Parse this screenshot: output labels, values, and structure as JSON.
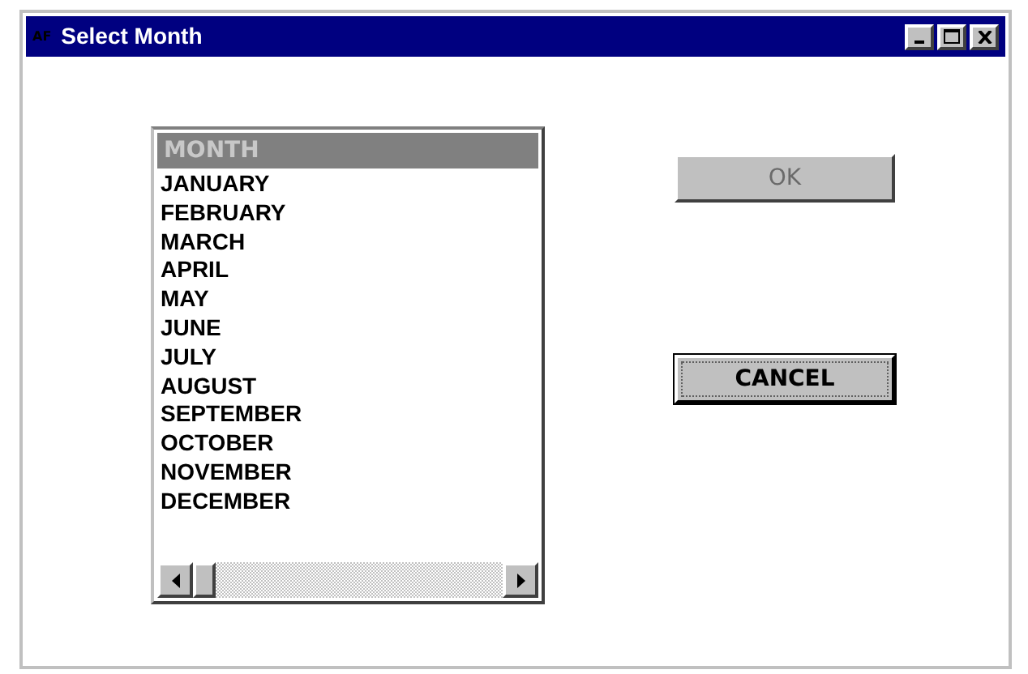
{
  "window": {
    "icon_text": "AF",
    "title": "Select Month"
  },
  "list": {
    "header": "MONTH",
    "items": [
      {
        "label": "JANUARY",
        "selected": false
      },
      {
        "label": "FEBRUARY",
        "selected": false
      },
      {
        "label": "MARCH",
        "selected": false
      },
      {
        "label": "APRIL",
        "selected": false
      },
      {
        "label": "MAY",
        "selected": false
      },
      {
        "label": "JUNE",
        "selected": false
      },
      {
        "label": "JULY",
        "selected": false
      },
      {
        "label": "AUGUST",
        "selected": false
      },
      {
        "label": "SEPTEMBER",
        "selected": false
      },
      {
        "label": "OCTOBER",
        "selected": false
      },
      {
        "label": "NOVEMBER",
        "selected": false
      },
      {
        "label": "DECEMBER",
        "selected": false
      }
    ]
  },
  "buttons": [
    {
      "label": "OK",
      "disabled": true,
      "focused": false
    },
    {
      "label": "CANCEL",
      "disabled": false,
      "focused": true
    }
  ]
}
